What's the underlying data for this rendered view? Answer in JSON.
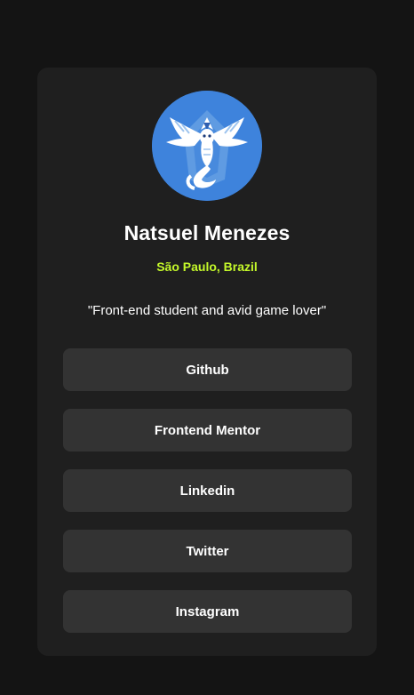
{
  "profile": {
    "avatar_icon": "lugia-avatar-icon",
    "name": "Natsuel Menezes",
    "location": "São Paulo, Brazil",
    "bio": "\"Front-end student and avid game lover\""
  },
  "links": [
    {
      "label": "Github"
    },
    {
      "label": "Frontend Mentor"
    },
    {
      "label": "Linkedin"
    },
    {
      "label": "Twitter"
    },
    {
      "label": "Instagram"
    }
  ],
  "colors": {
    "background": "#141414",
    "card": "#1f1f1f",
    "button": "#333333",
    "accent": "#c4f82a",
    "avatar_bg": "#3e83dc"
  }
}
